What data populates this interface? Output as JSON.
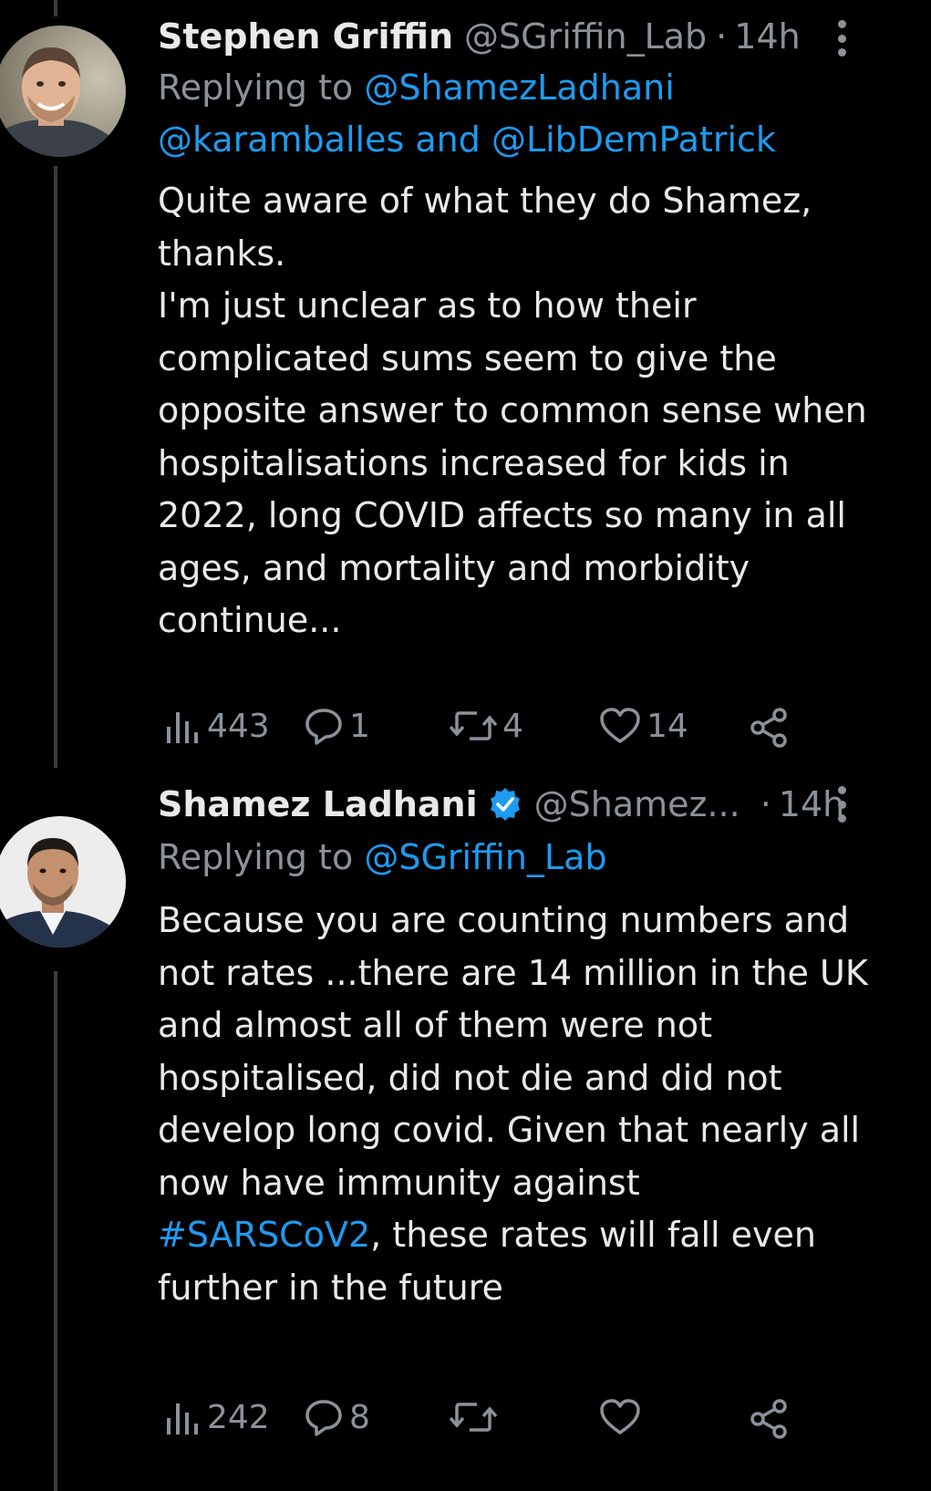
{
  "tweets": [
    {
      "name": "Stephen Griffin",
      "handle": "@SGriffin_Lab",
      "separator": "·",
      "time": "14h",
      "replying_prefix": "Replying to",
      "replying_to_1": "@ShamezLadhani",
      "replying_to_2": "@karamballes",
      "replying_and": "and",
      "replying_to_3": "@LibDemPatrick",
      "body_lines": [
        "Quite aware of what they do Shamez,",
        "thanks.",
        "I'm just unclear as to how their",
        "complicated sums seem to give the",
        "opposite answer to common sense when",
        "hospitalisations increased for kids in",
        "2022, long COVID affects so many in all",
        "ages, and mortality and morbidity",
        "continue..."
      ],
      "views": "443",
      "replies": "1",
      "retweets": "4",
      "likes": "14",
      "verified": false
    },
    {
      "name": "Shamez Ladhani",
      "handle": "@Shamez...",
      "separator": "·",
      "time": "14h",
      "replying_prefix": "Replying to",
      "replying_to_1": "@SGriffin_Lab",
      "body_lines": [
        "Because you are counting numbers and",
        "not rates ...there are 14 million in the UK",
        "and almost all of them were not",
        "hospitalised, did not die and did not",
        "develop long covid. Given that nearly all",
        "now have immunity against"
      ],
      "hashtag": "#SARSCoV2",
      "after_hashtag": ", these rates will fall even",
      "last_line": "further in the future",
      "views": "242",
      "replies": "8",
      "retweets": "",
      "likes": "",
      "verified": true
    }
  ],
  "icons": {
    "views": "views-bar-chart-icon",
    "reply": "reply-bubble-icon",
    "retweet": "retweet-icon",
    "like": "heart-icon",
    "share": "share-icon",
    "more": "more-options-icon",
    "verified": "verified-badge-icon"
  },
  "colors": {
    "background": "#000000",
    "text": "#e7e9ea",
    "muted": "#8b9299",
    "accent": "#1d9bf0"
  }
}
